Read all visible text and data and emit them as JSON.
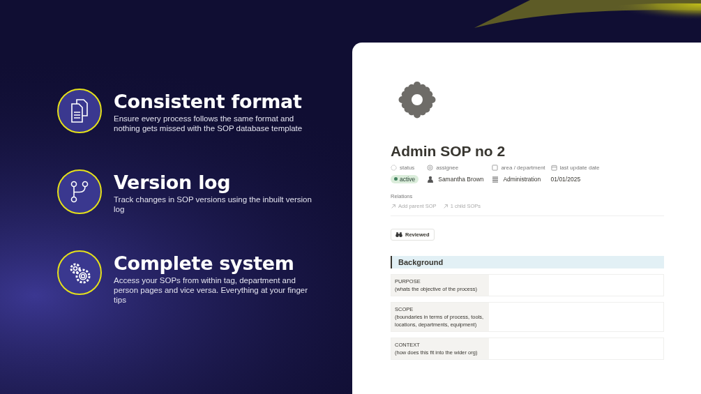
{
  "features": [
    {
      "kind": "documents",
      "title": "Consistent format",
      "description": "Ensure every process follows the same format and nothing gets missed with the SOP database template"
    },
    {
      "kind": "branch",
      "title": "Version log",
      "description": "Track changes in SOP versions using the inbuilt version log"
    },
    {
      "kind": "gears",
      "title": "Complete system",
      "description": "Access your SOPs from within tag, department and person pages and vice versa. Everything at your finger tips"
    }
  ],
  "page": {
    "title": "Admin SOP no 2",
    "properties": [
      {
        "kind": "status",
        "label": "status",
        "value": "active",
        "color": "#448361"
      },
      {
        "kind": "person",
        "label": "assignee",
        "value": "Samantha Brown"
      },
      {
        "kind": "relation",
        "label": "area / department",
        "value": "Administration"
      },
      {
        "kind": "date",
        "label": "last update date",
        "value": "01/01/2025"
      }
    ],
    "relations_label": "Relations",
    "relations": [
      "Add parent SOP",
      "1 child SOPs"
    ],
    "tag_button": "Reviewed",
    "section_heading": "Background",
    "rows": [
      {
        "label": "PURPOSE",
        "hint": "(whats the objective of the process)"
      },
      {
        "label": "SCOPE",
        "hint": "(boundaries in terms of process, tools, locations, departments, equipment)"
      },
      {
        "label": "CONTEXT",
        "hint": "(how does this fit into the wider org)"
      }
    ]
  }
}
